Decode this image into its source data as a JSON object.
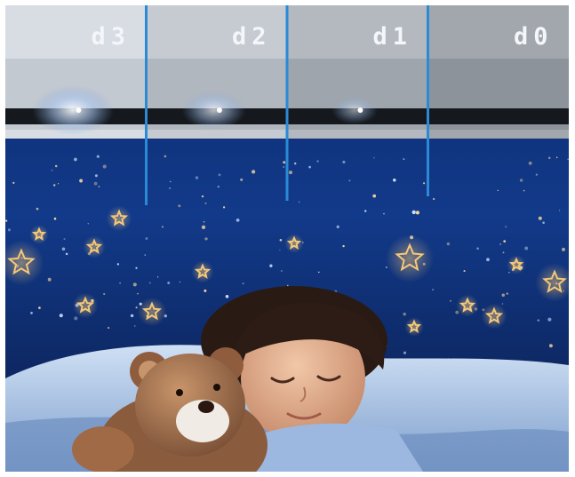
{
  "panels": [
    {
      "label": "d3",
      "light_level": 3
    },
    {
      "label": "d2",
      "light_level": 2
    },
    {
      "label": "d1",
      "light_level": 1
    },
    {
      "label": "d0",
      "light_level": 0
    }
  ],
  "colors": {
    "wall_top": "#e8ebee",
    "wall_bottom": "#b7bfc8",
    "night_sky": "#0d2a6b",
    "divider": "#2a8ad6",
    "star_glow": "#f5c878",
    "pillow": "#b8d0ec"
  }
}
